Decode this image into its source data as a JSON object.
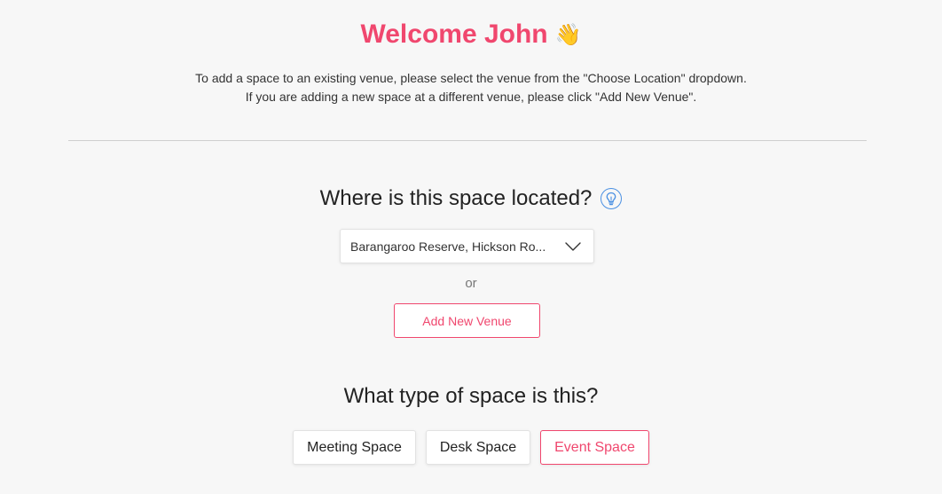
{
  "header": {
    "welcome": "Welcome John",
    "wave_emoji": "👋",
    "intro_line1": "To add a space to an existing venue, please select the venue from the \"Choose Location\" dropdown.",
    "intro_line2": "If you are adding a new space at a different venue, please click \"Add New Venue\"."
  },
  "location": {
    "question": "Where is this space located?",
    "info_icon": "lightbulb-icon",
    "selected_value": "Barangaroo Reserve, Hickson Ro...",
    "or_text": "or",
    "add_venue_label": "Add New Venue"
  },
  "space_type": {
    "question": "What type of space is this?",
    "options": [
      {
        "label": "Meeting Space",
        "selected": false
      },
      {
        "label": "Desk Space",
        "selected": false
      },
      {
        "label": "Event Space",
        "selected": true
      }
    ]
  },
  "colors": {
    "accent": "#f0476e",
    "info": "#4a90e2",
    "background": "#f7f7f7"
  }
}
